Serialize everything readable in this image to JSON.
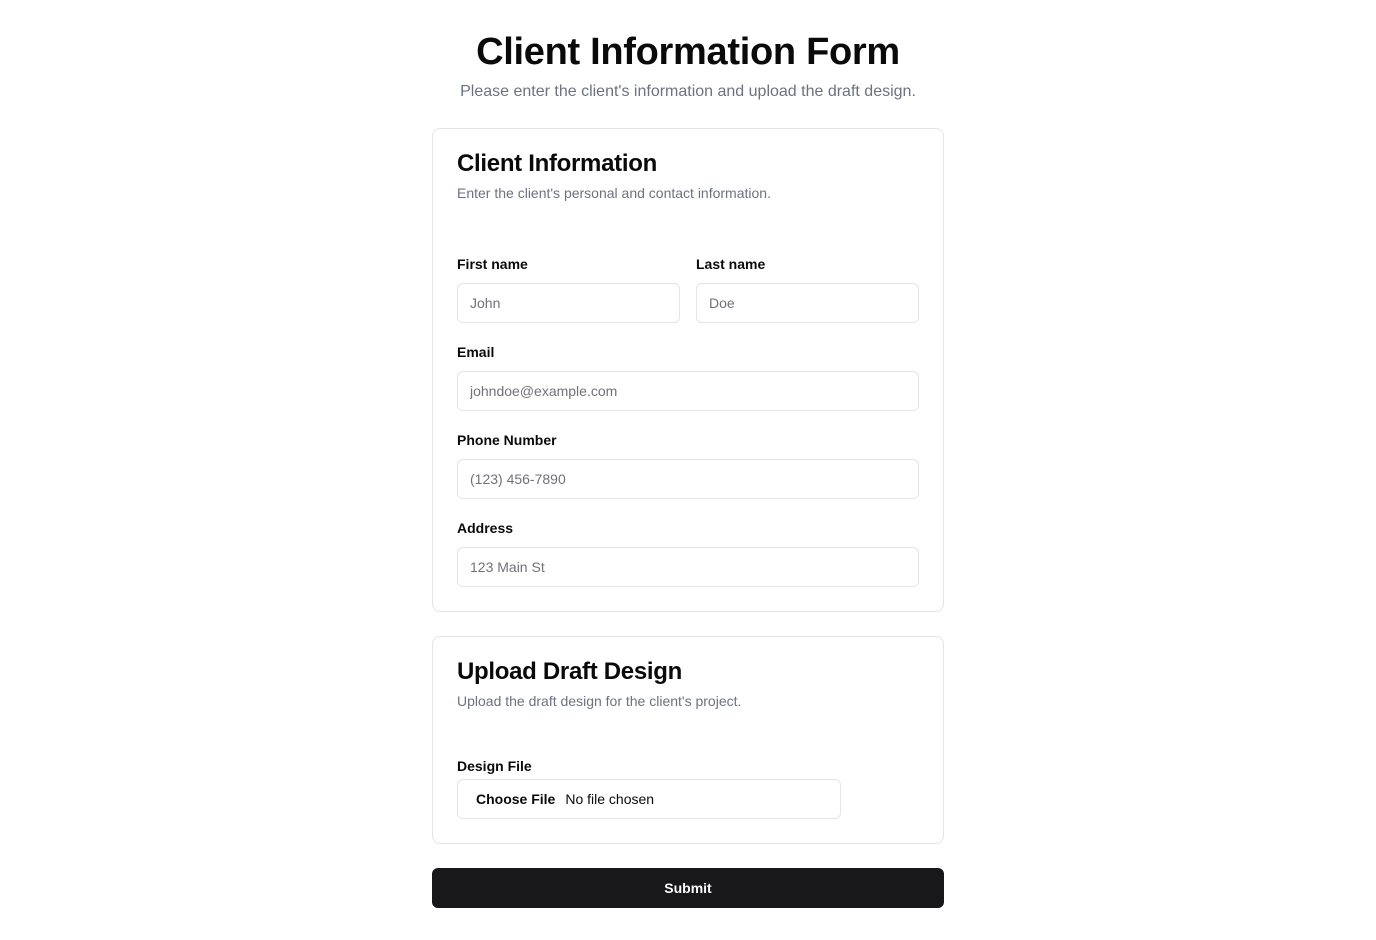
{
  "header": {
    "title": "Client Information Form",
    "subtitle": "Please enter the client's information and upload the draft design."
  },
  "client_info": {
    "title": "Client Information",
    "description": "Enter the client's personal and contact information.",
    "fields": {
      "first_name": {
        "label": "First name",
        "placeholder": "John",
        "value": ""
      },
      "last_name": {
        "label": "Last name",
        "placeholder": "Doe",
        "value": ""
      },
      "email": {
        "label": "Email",
        "placeholder": "johndoe@example.com",
        "value": ""
      },
      "phone": {
        "label": "Phone Number",
        "placeholder": "(123) 456-7890",
        "value": ""
      },
      "address": {
        "label": "Address",
        "placeholder": "123 Main St",
        "value": ""
      }
    }
  },
  "upload": {
    "title": "Upload Draft Design",
    "description": "Upload the draft design for the client's project.",
    "file_label": "Design File",
    "choose_label": "Choose File",
    "status": "No file chosen"
  },
  "submit_label": "Submit",
  "colors": {
    "primary": "#18181b",
    "border": "#e4e4e7",
    "muted_text": "#6b7280",
    "placeholder": "#71717a",
    "background": "#ffffff"
  }
}
